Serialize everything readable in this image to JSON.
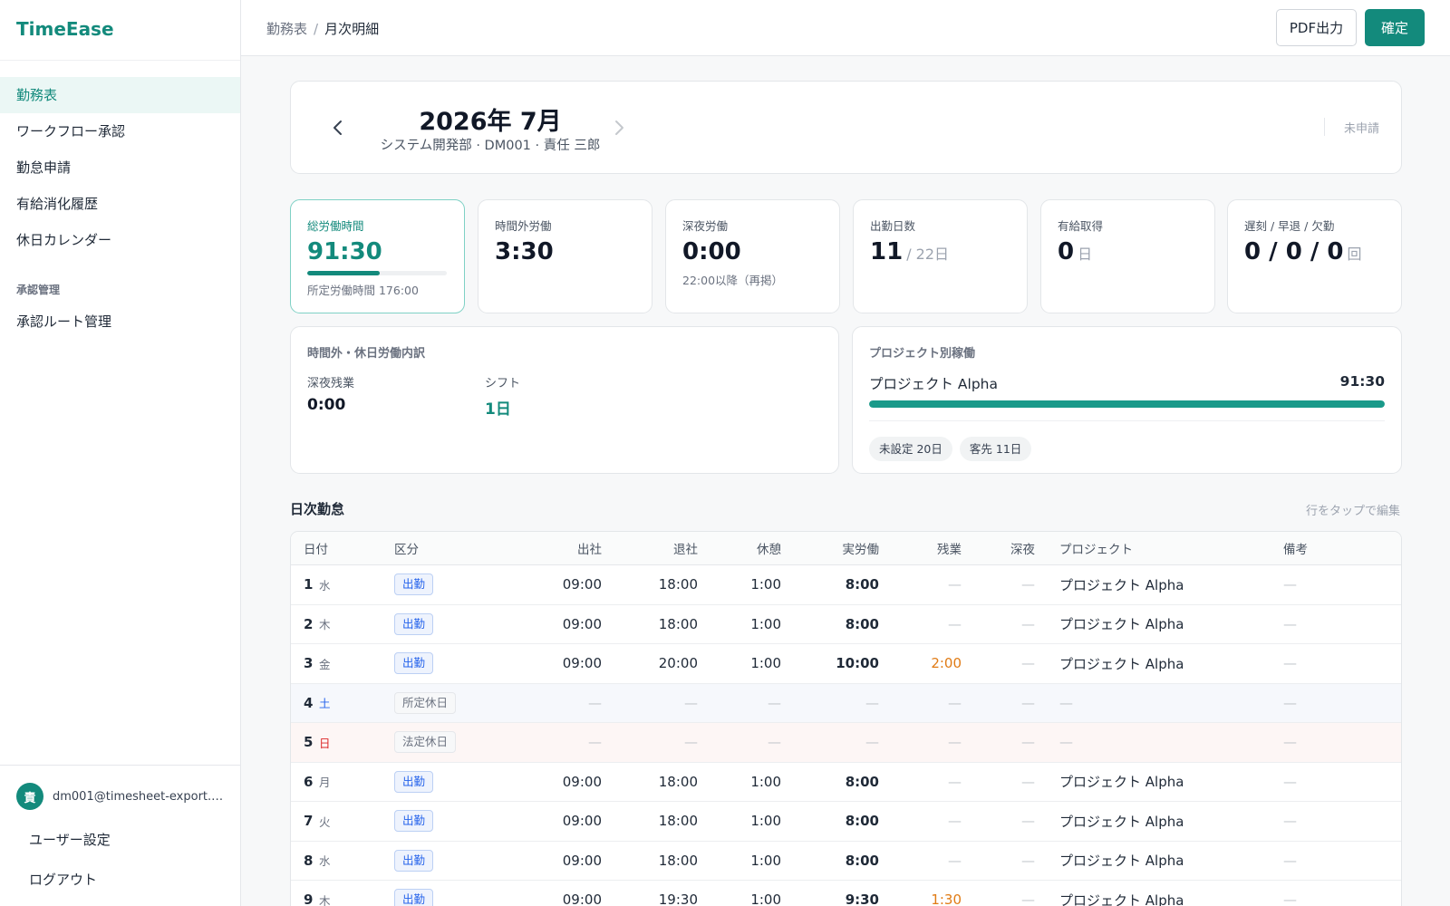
{
  "app": {
    "name": "TimeEase"
  },
  "sidebar": {
    "items": [
      {
        "label": "勤務表",
        "active": true
      },
      {
        "label": "ワークフロー承認"
      },
      {
        "label": "勤怠申請"
      },
      {
        "label": "有給消化履歴"
      },
      {
        "label": "休日カレンダー"
      }
    ],
    "section_label": "承認管理",
    "section_items": [
      {
        "label": "承認ルート管理"
      }
    ],
    "user": {
      "avatar": "責",
      "email": "dm001@timesheet-export.e..."
    },
    "bottom_links": [
      {
        "label": "ユーザー設定"
      },
      {
        "label": "ログアウト"
      }
    ]
  },
  "topbar": {
    "breadcrumb": [
      "勤務表",
      "月次明細"
    ],
    "breadcrumb_sep": "/",
    "pdf_label": "PDF出力",
    "confirm_label": "確定"
  },
  "month": {
    "title": "2026年 7月",
    "subtitle": "システム開発部 · DM001 · 責任 三郎",
    "status": "未申請"
  },
  "stats": [
    {
      "label": "総労働時間",
      "value": "91:30",
      "note": "所定労働時間 176:00",
      "progress": 0.52
    },
    {
      "label": "時間外労働",
      "value": "3:30"
    },
    {
      "label": "深夜労働",
      "value": "0:00",
      "note": "22:00以降（再掲）"
    },
    {
      "label": "出勤日数",
      "value": "11",
      "unit": "/ 22日"
    },
    {
      "label": "有給取得",
      "value": "0",
      "unit": "日"
    },
    {
      "label": "遅刻 / 早退 / 欠勤",
      "value": "0 / 0 / 0",
      "unit": "回"
    }
  ],
  "breakdown": {
    "title": "時間外・休日労働内訳",
    "items": [
      {
        "label": "深夜残業",
        "value": "0:00"
      },
      {
        "label": "シフト",
        "value": "1日"
      }
    ]
  },
  "projects": {
    "title": "プロジェクト別稼働",
    "rows": [
      {
        "name": "プロジェクト Alpha",
        "hours": "91:30",
        "share": 1.0
      }
    ],
    "chips": [
      "未設定 20日",
      "客先 11日"
    ]
  },
  "daily": {
    "title": "日次勤怠",
    "hint": "行をタップで編集",
    "columns": [
      "日付",
      "区分",
      "出社",
      "退社",
      "休憩",
      "実労働",
      "残業",
      "深夜",
      "プロジェクト",
      "備考"
    ],
    "rows": [
      {
        "day": "1",
        "dow": "水",
        "type": "出勤",
        "in": "09:00",
        "out": "18:00",
        "break": "1:00",
        "actual": "8:00",
        "ot": "—",
        "night": "—",
        "project": "プロジェクト Alpha",
        "note": "—"
      },
      {
        "day": "2",
        "dow": "木",
        "type": "出勤",
        "in": "09:00",
        "out": "18:00",
        "break": "1:00",
        "actual": "8:00",
        "ot": "—",
        "night": "—",
        "project": "プロジェクト Alpha",
        "note": "—"
      },
      {
        "day": "3",
        "dow": "金",
        "type": "出勤",
        "in": "09:00",
        "out": "20:00",
        "break": "1:00",
        "actual": "10:00",
        "ot": "2:00",
        "night": "—",
        "project": "プロジェクト Alpha",
        "note": "—"
      },
      {
        "day": "4",
        "dow": "土",
        "type": "所定休日",
        "in": "—",
        "out": "—",
        "break": "—",
        "actual": "—",
        "ot": "—",
        "night": "—",
        "project": "—",
        "note": "—"
      },
      {
        "day": "5",
        "dow": "日",
        "type": "法定休日",
        "in": "—",
        "out": "—",
        "break": "—",
        "actual": "—",
        "ot": "—",
        "night": "—",
        "project": "—",
        "note": "—"
      },
      {
        "day": "6",
        "dow": "月",
        "type": "出勤",
        "in": "09:00",
        "out": "18:00",
        "break": "1:00",
        "actual": "8:00",
        "ot": "—",
        "night": "—",
        "project": "プロジェクト Alpha",
        "note": "—"
      },
      {
        "day": "7",
        "dow": "火",
        "type": "出勤",
        "in": "09:00",
        "out": "18:00",
        "break": "1:00",
        "actual": "8:00",
        "ot": "—",
        "night": "—",
        "project": "プロジェクト Alpha",
        "note": "—"
      },
      {
        "day": "8",
        "dow": "水",
        "type": "出勤",
        "in": "09:00",
        "out": "18:00",
        "break": "1:00",
        "actual": "8:00",
        "ot": "—",
        "night": "—",
        "project": "プロジェクト Alpha",
        "note": "—"
      },
      {
        "day": "9",
        "dow": "木",
        "type": "出勤",
        "in": "09:00",
        "out": "19:30",
        "break": "1:00",
        "actual": "9:30",
        "ot": "1:30",
        "night": "—",
        "project": "プロジェクト Alpha",
        "note": "—"
      }
    ]
  },
  "colors": {
    "accent": "#138a7c",
    "work_tag": "#2563eb",
    "overtime": "#e07b15",
    "sunday": "#dc2626",
    "saturday": "#2563eb"
  }
}
